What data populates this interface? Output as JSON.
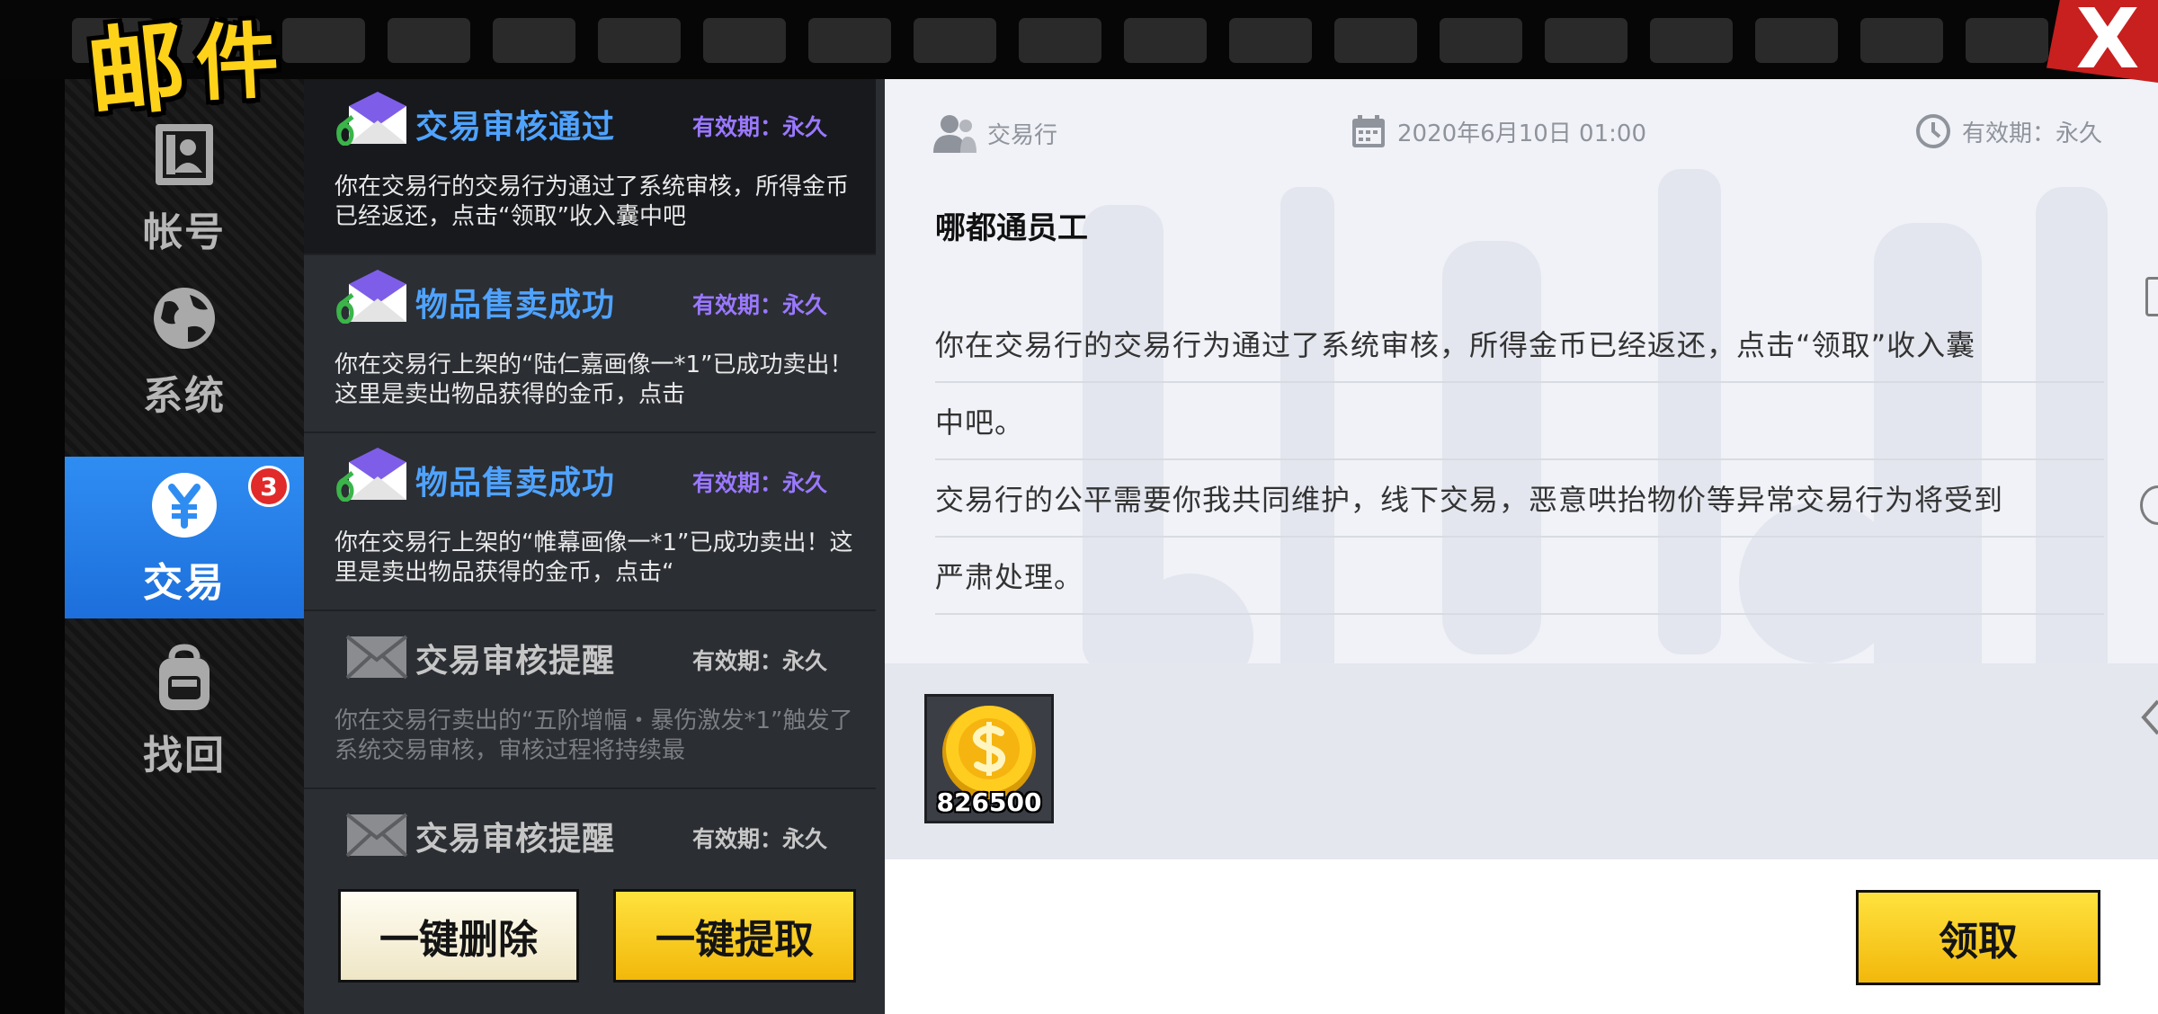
{
  "title": {
    "char1": "邮",
    "char2": "件"
  },
  "close_label": "X",
  "colors": {
    "accent_blue": "#2f8df2",
    "unread_title": "#4fa3ff",
    "expiry_purple": "#9a78ff",
    "button_gold": "#f2b80b",
    "badge_red": "#e12a2a"
  },
  "nav": {
    "items": [
      {
        "label": "帐号",
        "icon": "id-card-icon"
      },
      {
        "label": "系统",
        "icon": "globe-icon"
      },
      {
        "label": "交易",
        "icon": "yen-coin-icon",
        "badge": "3",
        "active": true
      },
      {
        "label": "找回",
        "icon": "backpack-icon"
      }
    ]
  },
  "mail_list": {
    "items": [
      {
        "title": "交易审核通过",
        "expiry": "有效期：永久",
        "preview": "你在交易行的交易行为通过了系统审核，所得金币已经返还，点击“领取”收入囊中吧",
        "state": "selected"
      },
      {
        "title": "物品售卖成功",
        "expiry": "有效期：永久",
        "preview": "你在交易行上架的“陆仁嘉画像一*1”已成功卖出！这里是卖出物品获得的金币，点击",
        "state": "unread"
      },
      {
        "title": "物品售卖成功",
        "expiry": "有效期：永久",
        "preview": "你在交易行上架的“帷幕画像一*1”已成功卖出！这里是卖出物品获得的金币，点击“",
        "state": "unread"
      },
      {
        "title": "交易审核提醒",
        "expiry": "有效期：永久",
        "preview": "你在交易行卖出的“五阶增幅・暴伤激发*1”触发了系统交易审核，审核过程将持续最",
        "state": "read"
      },
      {
        "title": "交易审核提醒",
        "expiry": "有效期：永久",
        "preview": "",
        "state": "read"
      }
    ]
  },
  "footer": {
    "delete_all": "一键删除",
    "collect_all": "一键提取"
  },
  "detail": {
    "sender": "交易行",
    "date": "2020年6月10日  01:00",
    "expiry": "有效期：永久",
    "recipient": "哪都通员工",
    "body_lines": [
      "你在交易行的交易行为通过了系统审核，所得金币已经返还，点击“领取”收入囊",
      "中吧。",
      "交易行的公平需要你我共同维护，线下交易，恶意哄抬物价等异常交易行为将受到",
      "严肃处理。"
    ],
    "attachment": {
      "icon": "gold-coin-icon",
      "quantity": "826500"
    },
    "claim_label": "领取"
  }
}
